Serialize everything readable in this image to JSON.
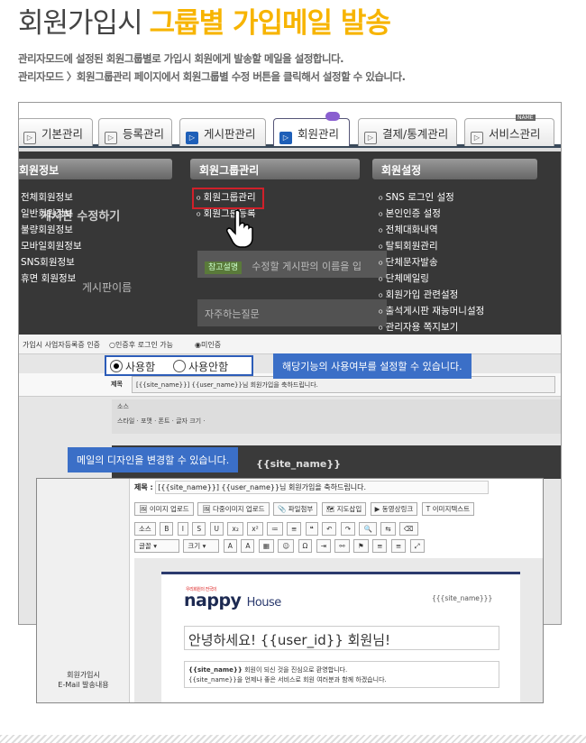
{
  "header": {
    "title_light": "회원가입시",
    "title_bold": "그룹별 가입메일 발송",
    "desc1": "관리자모드에 설정된 회원그룹별로 가입시 회원에게 발송할 메일을 설정합니다.",
    "desc2": "관리자모드 〉회원그룹관리 페이지에서 회원그룹별 수정 버튼을 클릭해서 설정할 수 있습니다."
  },
  "tabs": [
    {
      "label": "기본관리"
    },
    {
      "label": "등록관리"
    },
    {
      "label": "게시판관리"
    },
    {
      "label": "회원관리"
    },
    {
      "label": "결제/통계관리"
    },
    {
      "label": "서비스관리"
    }
  ],
  "tab_badge": "NAME",
  "menu": {
    "col1_title": "회원정보",
    "col1_items": [
      "전체회원정보",
      "일반회원정보",
      "불량회원정보",
      "모바일회원정보",
      "SNS회원정보",
      "휴면 회원정보"
    ],
    "col2_title": "회원그룹관리",
    "col2_items": [
      "회원그룹관리",
      "회원그룹등록"
    ],
    "col3_title": "회원설정",
    "col3_items": [
      "SNS 로그인 설정",
      "본인인증 설정",
      "전체대화내역",
      "탈퇴회원관리",
      "단체문자발송",
      "단체메일링",
      "회원가입 관련설정",
      "출석게시판 재능머니설정",
      "관리자용 쪽지보기"
    ]
  },
  "background": {
    "edit_board": "게시판 수정하기",
    "board_name": "게시판이름",
    "hint_badge": "참고설명",
    "hint_text": "수정할 게시판의 이름을 입",
    "faq": "자주하는질문"
  },
  "settings": {
    "row_label": "가입시 사업자등록증 인증",
    "auth_option": "인증후 로그인 가능",
    "no_auth_option": "미인증",
    "use_label": "사용함",
    "unuse_label": "사용안함",
    "subject_label": "제목",
    "subject_value": "[{{site_name}}] {{user_name}}님 회원가입을 축하드립니다.",
    "editor_tools1": "소스",
    "editor_tools2": "스타일 · 포맷 · 폰트 · 글자 크기 ·",
    "dark_title": "{{site_name}}"
  },
  "tooltips": {
    "usage": "해당기능의 사용여부를 설정할 수 있습니다.",
    "design": "메일의 디자인을 변경할 수 있습니다."
  },
  "popup": {
    "side_label": "회원가입시\nE-Mail 발송내용",
    "subject_label": "제목 :",
    "subject_value": "[{{site_name}}] {{user_name}}님 회원가입을 축하드립니다.",
    "toolbar1": [
      "이미지 업로드",
      "다중이미지 업로드",
      "파일첨부",
      "지도삽입",
      "동영상링크",
      "이미지텍스트"
    ],
    "toolbar2": [
      "소스",
      "B",
      "I",
      "S",
      "U",
      "x₂",
      "x²",
      "≔",
      "≡",
      "❝",
      "”",
      "↶",
      "↷",
      "🔍",
      "⇆",
      "⌫"
    ],
    "font_select": "글꼴",
    "size_select": "크기",
    "toolbar3": [
      "A",
      "A",
      "▦",
      "☺",
      "Ω",
      "⇥",
      "⚯",
      "⚑",
      "≡",
      "≡",
      "≡",
      "≡",
      "⤢"
    ]
  },
  "mail": {
    "logo_small": "우리회원의 전국의",
    "logo_main": "nappy",
    "logo_house": "House",
    "site_name": "{{site_name}}",
    "greeting": "안녕하세요! {{user_id}} 회원님!",
    "line1_bold": "{{site_name}}",
    "line1_rest": " 회원이 되신 것을 진심으로 환영합니다.",
    "line2": "{{site_name}}을 언제나 좋은 서비스로 회원 여러분과 함께 하겠습니다."
  },
  "colors": {
    "accent": "#f7b400",
    "tab_blue": "#1e5fb8",
    "tooltip": "#3b6fc7",
    "highlight": "#d0202a"
  }
}
